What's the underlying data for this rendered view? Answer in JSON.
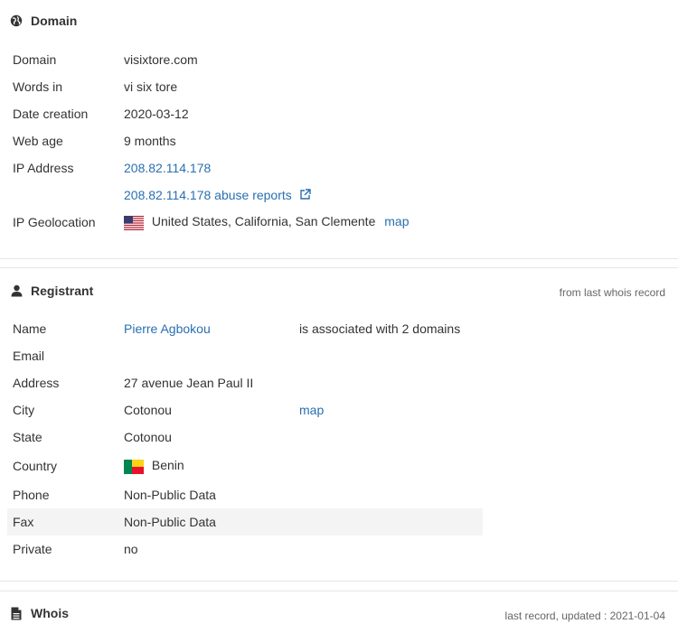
{
  "domain_section": {
    "title": "Domain",
    "rows": [
      {
        "label": "Domain",
        "value": "visixtore.com"
      },
      {
        "label": "Words in",
        "value": "vi six tore"
      },
      {
        "label": "Date creation",
        "value": "2020-03-12"
      },
      {
        "label": "Web age",
        "value": "9 months"
      },
      {
        "label": "IP Address",
        "value": "208.82.114.178"
      }
    ],
    "abuse_link": "208.82.114.178 abuse reports",
    "geo_label": "IP Geolocation",
    "geo_value": "United States, California, San Clemente",
    "geo_map": "map"
  },
  "registrant_section": {
    "title": "Registrant",
    "meta": "from last whois record",
    "name_label": "Name",
    "name_value": "Pierre Agbokou",
    "name_extra": "is associated with 2 domains",
    "email_label": "Email",
    "email_value": "",
    "address_label": "Address",
    "address_value": "27 avenue Jean Paul II",
    "city_label": "City",
    "city_value": "Cotonou",
    "city_map": "map",
    "state_label": "State",
    "state_value": "Cotonou",
    "country_label": "Country",
    "country_value": "Benin",
    "phone_label": "Phone",
    "phone_value": "Non-Public Data",
    "fax_label": "Fax",
    "fax_value": "Non-Public Data",
    "private_label": "Private",
    "private_value": "no"
  },
  "whois_section": {
    "title": "Whois",
    "meta": "last record, updated : 2021-01-04"
  },
  "icons": {
    "domain": "globe-icon",
    "registrant": "user-icon",
    "whois": "document-icon",
    "external": "external-link-icon"
  },
  "colors": {
    "link": "#2a6fb0",
    "text": "#333333",
    "divider": "#e6e6e6",
    "row_highlight": "#f4f4f4"
  }
}
